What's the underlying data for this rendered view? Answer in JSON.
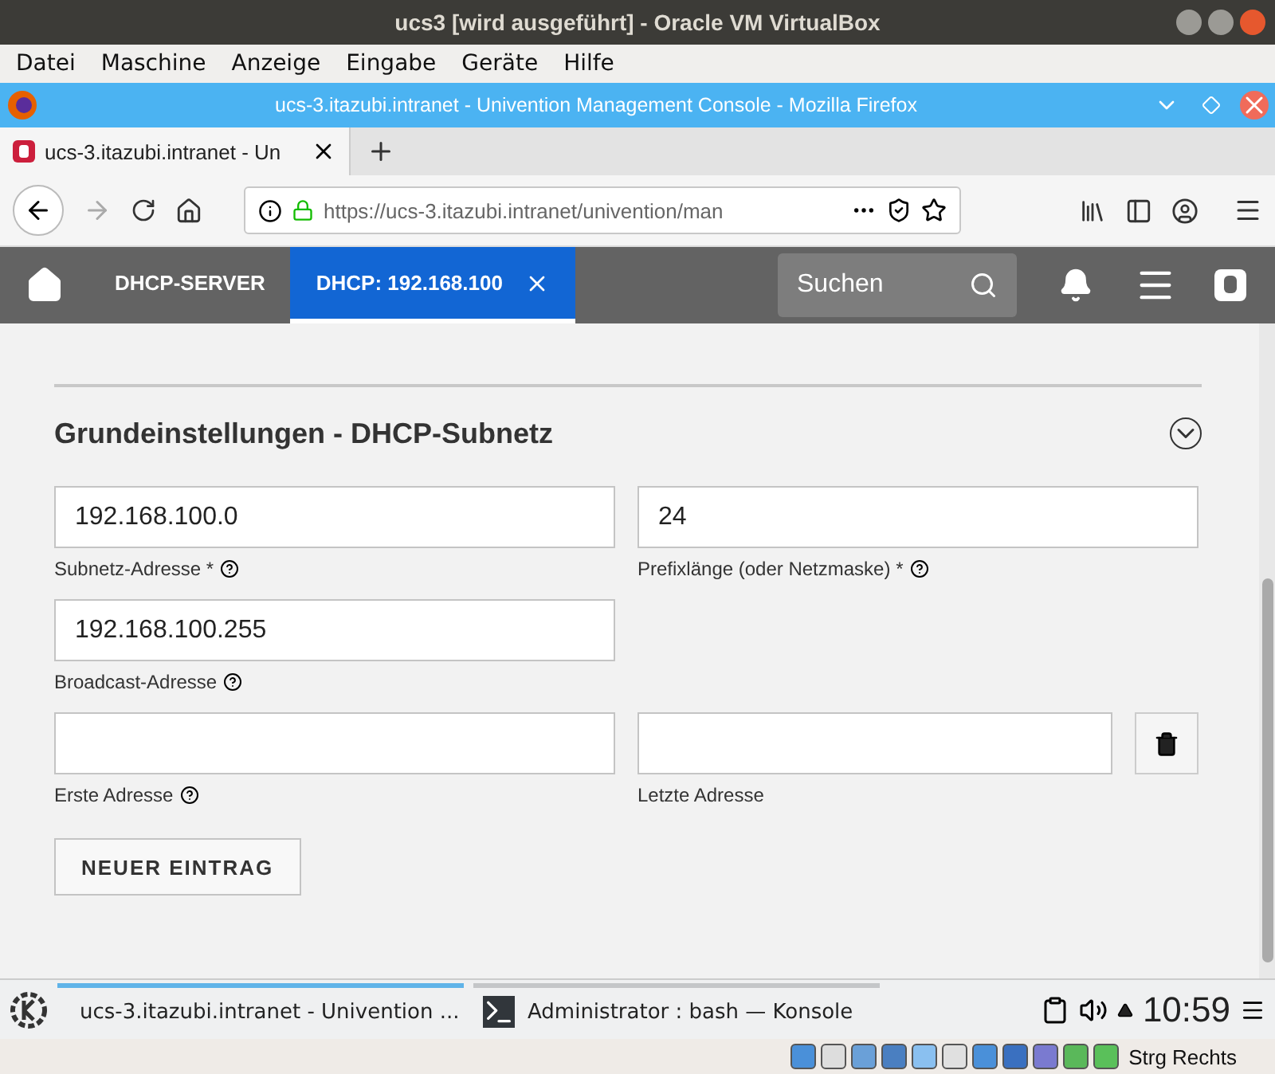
{
  "vm_window": {
    "title": "ucs3 [wird ausgeführt] - Oracle VM VirtualBox",
    "menu": [
      "Datei",
      "Maschine",
      "Anzeige",
      "Eingabe",
      "Geräte",
      "Hilfe"
    ]
  },
  "browser": {
    "title": "ucs-3.itazubi.intranet - Univention Management Console - Mozilla Firefox",
    "tabs": [
      {
        "label": "ucs-3.itazubi.intranet - Un",
        "selected": true
      }
    ],
    "url": "https://ucs-3.itazubi.intranet/univention/man"
  },
  "umc": {
    "tabs": [
      {
        "label": "DHCP-SERVER",
        "selected": false,
        "closable": false
      },
      {
        "label": "DHCP: 192.168.100",
        "selected": true,
        "closable": true
      }
    ],
    "search": {
      "placeholder": "Suchen"
    },
    "section_title": "Grundeinstellungen - DHCP-Subnetz",
    "field_rows": [
      {
        "fields": [
          {
            "label": "Subnetz-Adresse *",
            "value": "192.168.100.0",
            "help": true
          },
          {
            "label": "Prefixlänge (oder Netzmaske) *",
            "value": "24",
            "help": true
          }
        ],
        "deletable": false
      },
      {
        "fields": [
          {
            "label": "Broadcast-Adresse",
            "value": "192.168.100.255",
            "help": true
          }
        ],
        "deletable": false
      },
      {
        "fields": [
          {
            "label": "Erste Adresse",
            "help": true
          },
          {
            "label": "Letzte Adresse",
            "help": false
          }
        ],
        "deletable": true
      }
    ],
    "add_button": "NEUER EINTRAG"
  },
  "taskbar": {
    "tasks": [
      {
        "label": "ucs-3.itazubi.intranet - Univention ...",
        "kind": "firefox",
        "selected": true
      },
      {
        "label": "Administrator : bash — Konsole",
        "kind": "terminal",
        "selected": false
      }
    ],
    "clock": "10:59"
  },
  "vm_status": {
    "host_key": "Strg Rechts"
  }
}
